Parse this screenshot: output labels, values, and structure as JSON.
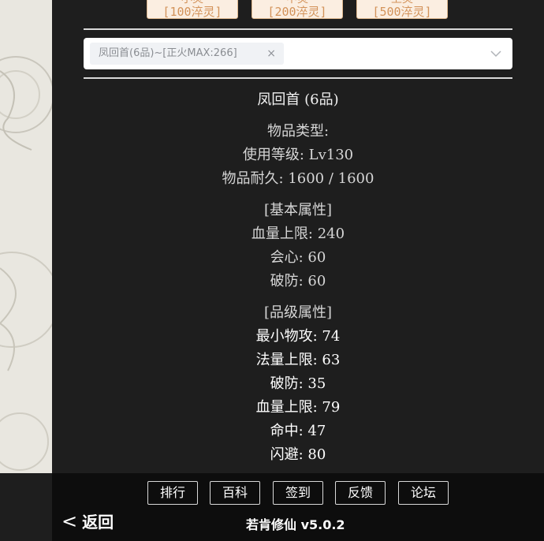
{
  "buy_buttons": [
    {
      "top_label": "小灵",
      "price": "[100淬灵]"
    },
    {
      "top_label": "中灵",
      "price": "[200淬灵]"
    },
    {
      "top_label": "上灵",
      "price": "[500淬灵]"
    }
  ],
  "select": {
    "selected_tag": "凤回首(6品)~[正火MAX:266]",
    "close_glyph": "×"
  },
  "item": {
    "title": "凤回首 (6品)",
    "type_line": "物品类型:",
    "level_line": "使用等级: Lv130",
    "durability_line": "物品耐久: 1600 / 1600",
    "base_header": "[基本属性]",
    "base_stats": [
      "血量上限: 240",
      "会心: 60",
      "破防: 60"
    ],
    "grade_header": "[品级属性]",
    "grade_stats": [
      "最小物攻: 74",
      "法量上限: 63",
      "破防: 35",
      "血量上限: 79",
      "命中: 47",
      "闪避: 80"
    ]
  },
  "footer": {
    "nav": [
      "排行",
      "百科",
      "签到",
      "反馈",
      "论坛"
    ],
    "back_label": "返回",
    "back_arrow": "<",
    "version": "若肯修仙 v5.0.2"
  },
  "colors": {
    "background": "#1e1e1e",
    "footer": "#0d0d0d",
    "buy_button_bg": "#fbeee1",
    "buy_button_text": "#d3935a"
  }
}
